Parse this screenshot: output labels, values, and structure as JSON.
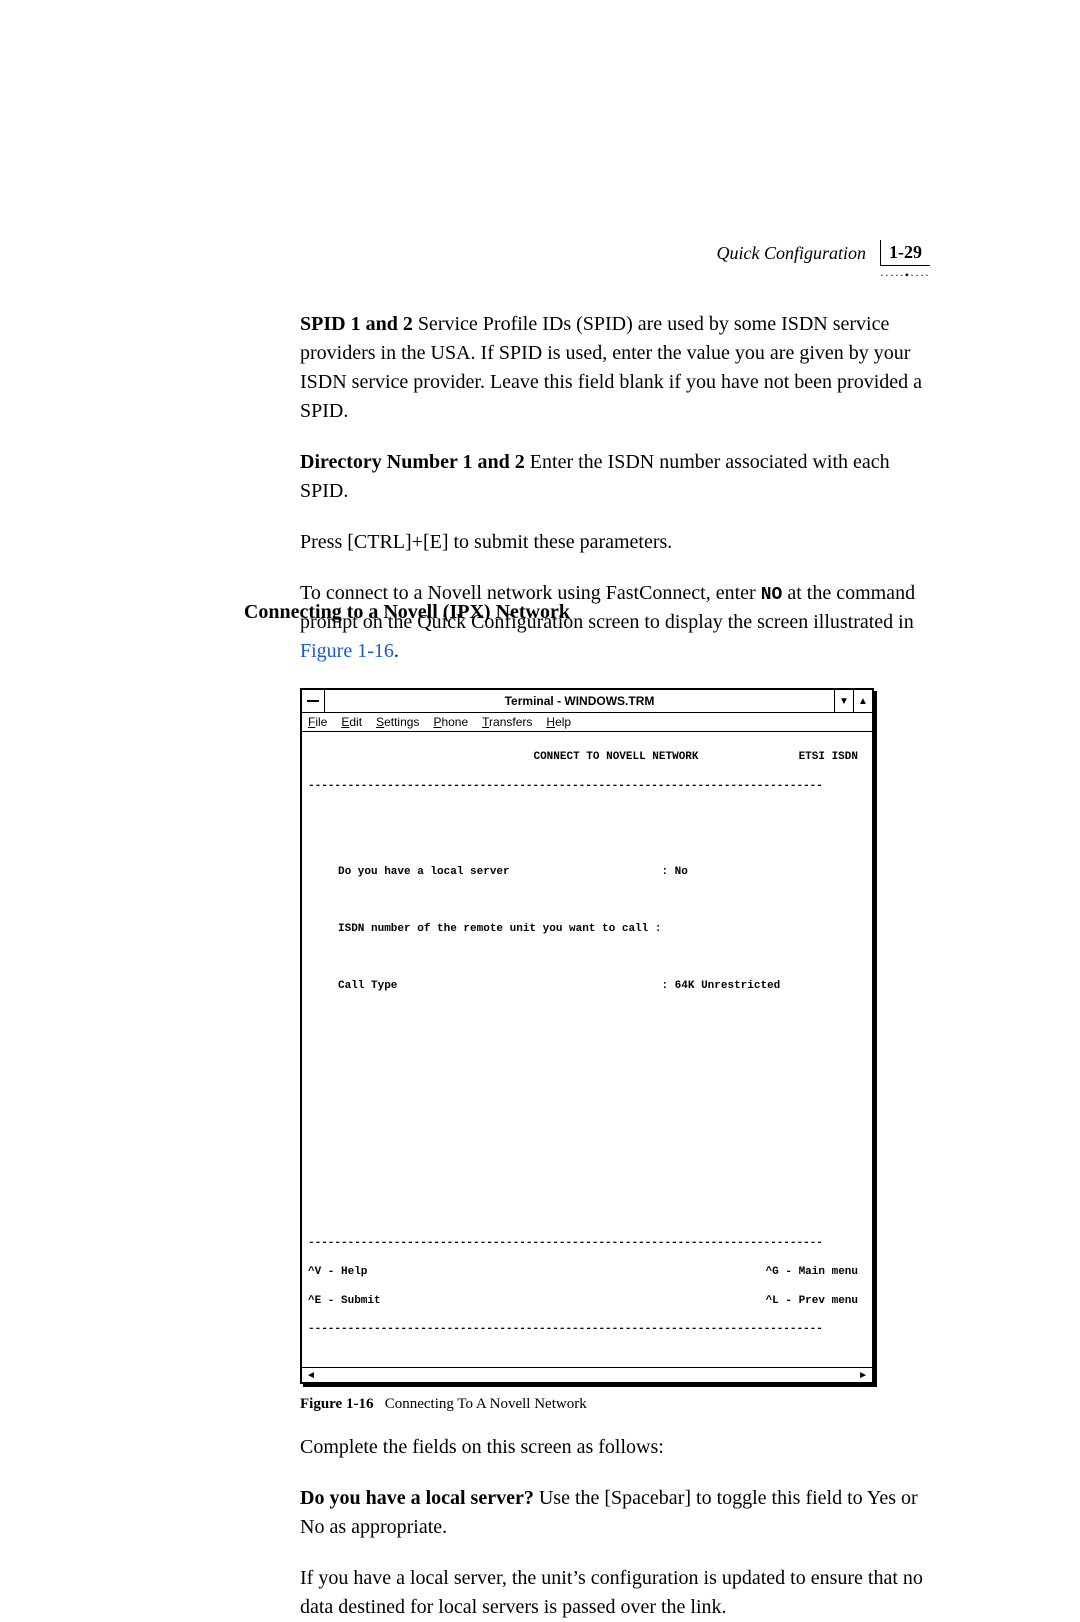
{
  "running_head": {
    "title": "Quick Configuration",
    "page_number": "1-29",
    "dots": "·····•····"
  },
  "spid": {
    "heading": "SPID 1 and 2",
    "text": " Service Profile IDs (SPID) are used by some ISDN service providers in the USA. If SPID is used, enter the value you are given by your ISDN service provider. Leave this field blank if you have not been provided a SPID."
  },
  "dirnum": {
    "heading": "Directory Number 1 and 2",
    "text": " Enter the ISDN number associated with each SPID."
  },
  "submit_hint": "Press [CTRL]+[E] to submit these parameters.",
  "section_heading": "Connecting to a Novell (IPX) Network",
  "connect_para": {
    "pre": "To connect to a Novell network using FastConnect, enter ",
    "cmd": "NO",
    "mid": " at the command prompt on the Quick Configuration screen to display the screen illustrated in ",
    "link": "Figure 1-16",
    "post": "."
  },
  "terminal": {
    "title": "Terminal - WINDOWS.TRM",
    "menus": [
      "File",
      "Edit",
      "Settings",
      "Phone",
      "Transfers",
      "Help"
    ],
    "hdr_center": "CONNECT TO NOVELL NETWORK",
    "hdr_right": "ETSI ISDN",
    "q1_label": "Do you have a local server",
    "q1_value": ": No",
    "q2_label": "ISDN number of the remote unit you want to call :",
    "q3_label": "Call Type",
    "q3_value": ": 64K Unrestricted",
    "foot_l1": "^V - Help",
    "foot_r1": "^G - Main menu",
    "foot_l2": "^E - Submit",
    "foot_r2": "^L - Prev menu"
  },
  "figure_caption": {
    "label": "Figure 1-16",
    "text": "Connecting To A Novell Network"
  },
  "complete_fields": "Complete the fields on this screen as follows:",
  "local_server_q": {
    "heading": "Do you have a local server?",
    "text": " Use the [Spacebar] to toggle this field to Yes or No as appropriate."
  },
  "local_server_note": "If you have a local server, the unit’s configuration is updated to ensure that no data destined for local servers is passed over the link."
}
